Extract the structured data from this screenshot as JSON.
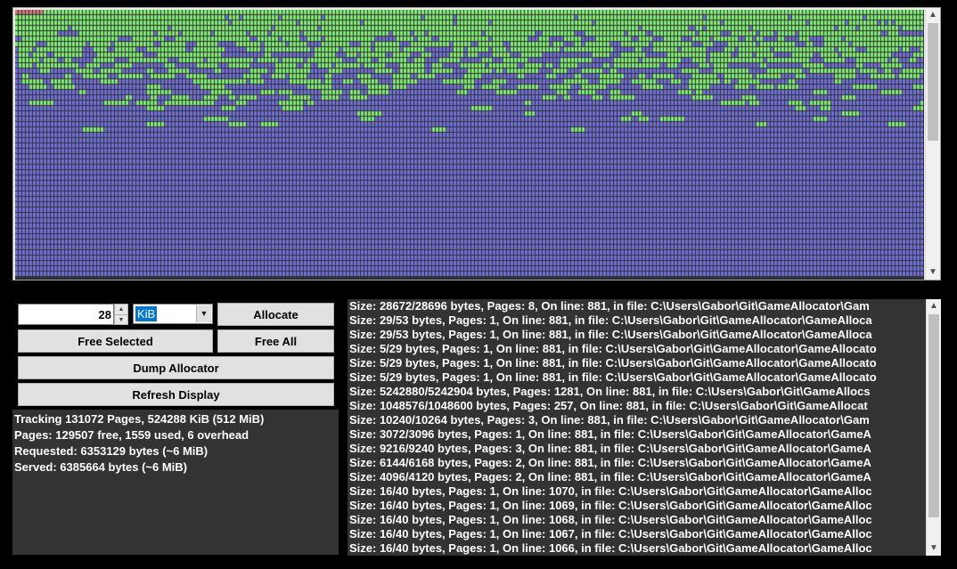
{
  "page_map": {
    "colors": {
      "used": "#7070d8",
      "free": "#80f070",
      "reserved": "#d87878",
      "grid_line": "#303038"
    },
    "scrollbar": {
      "up_icon": "scroll-up-arrow-icon",
      "down_icon": "scroll-down-arrow-icon"
    }
  },
  "controls": {
    "size_value": "28",
    "unit_selected": "KiB",
    "allocate_label": "Allocate",
    "free_selected_label": "Free Selected",
    "free_all_label": "Free All",
    "dump_label": "Dump Allocator",
    "refresh_label": "Refresh Display"
  },
  "stats": {
    "tracking": "Tracking 131072 Pages, 524288 KiB (512 MiB)",
    "pages": "Pages: 129507 free, 1559 used, 6 overhead",
    "requested": "Requested: 6353129 bytes (~6 MiB)",
    "served": "Served: 6385664 bytes (~6 MiB)"
  },
  "log": {
    "lines": [
      "Size: 28672/28696 bytes, Pages: 8, On line: 881, in file: C:\\Users\\Gabor\\Git\\GameAllocator\\Gam",
      "Size: 29/53 bytes, Pages: 1, On line: 881, in file: C:\\Users\\Gabor\\Git\\GameAllocator\\GameAlloca",
      "Size: 29/53 bytes, Pages: 1, On line: 881, in file: C:\\Users\\Gabor\\Git\\GameAllocator\\GameAlloca",
      "Size: 5/29 bytes, Pages: 1, On line: 881, in file: C:\\Users\\Gabor\\Git\\GameAllocator\\GameAllocato",
      "Size: 5/29 bytes, Pages: 1, On line: 881, in file: C:\\Users\\Gabor\\Git\\GameAllocator\\GameAllocato",
      "Size: 5/29 bytes, Pages: 1, On line: 881, in file: C:\\Users\\Gabor\\Git\\GameAllocator\\GameAllocato",
      "Size: 5242880/5242904 bytes, Pages: 1281, On line: 881, in file: C:\\Users\\Gabor\\Git\\GameAllocs",
      "Size: 1048576/1048600 bytes, Pages: 257, On line: 881, in file: C:\\Users\\Gabor\\Git\\GameAllocat",
      "Size: 10240/10264 bytes, Pages: 3, On line: 881, in file: C:\\Users\\Gabor\\Git\\GameAllocator\\Gam",
      "Size: 3072/3096 bytes, Pages: 1, On line: 881, in file: C:\\Users\\Gabor\\Git\\GameAllocator\\GameA",
      "Size: 9216/9240 bytes, Pages: 3, On line: 881, in file: C:\\Users\\Gabor\\Git\\GameAllocator\\GameA",
      "Size: 6144/6168 bytes, Pages: 2, On line: 881, in file: C:\\Users\\Gabor\\Git\\GameAllocator\\GameA",
      "Size: 4096/4120 bytes, Pages: 2, On line: 881, in file: C:\\Users\\Gabor\\Git\\GameAllocator\\GameA",
      "Size: 16/40 bytes, Pages: 1, On line: 1070, in file: C:\\Users\\Gabor\\Git\\GameAllocator\\GameAlloc",
      "Size: 16/40 bytes, Pages: 1, On line: 1069, in file: C:\\Users\\Gabor\\Git\\GameAllocator\\GameAlloc",
      "Size: 16/40 bytes, Pages: 1, On line: 1068, in file: C:\\Users\\Gabor\\Git\\GameAllocator\\GameAlloc",
      "Size: 16/40 bytes, Pages: 1, On line: 1067, in file: C:\\Users\\Gabor\\Git\\GameAllocator\\GameAlloc",
      "Size: 16/40 bytes, Pages: 1, On line: 1066, in file: C:\\Users\\Gabor\\Git\\GameAllocator\\GameAlloc"
    ]
  }
}
